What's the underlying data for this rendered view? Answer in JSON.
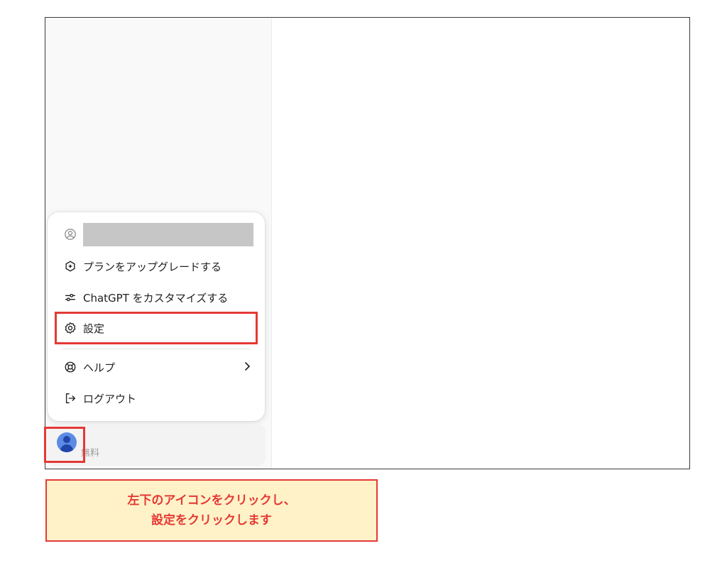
{
  "menu": {
    "account_icon": "user-circle-icon",
    "items": [
      {
        "label": "プランをアップグレードする",
        "icon": "upgrade-sparkle-icon"
      },
      {
        "label": "ChatGPT をカスタマイズする",
        "icon": "sliders-icon"
      },
      {
        "label": "設定",
        "icon": "gear-icon"
      },
      {
        "label": "ヘルプ",
        "icon": "lifebuoy-icon",
        "has_submenu": true
      },
      {
        "label": "ログアウト",
        "icon": "logout-icon"
      }
    ]
  },
  "profile": {
    "plan_label": "無料",
    "avatar_icon": "avatar-icon"
  },
  "callout": {
    "line1": "左下のアイコンをクリックし、",
    "line2": "設定をクリックします"
  },
  "colors": {
    "highlight": "#e53935",
    "callout_bg": "#fff2c8",
    "callout_text": "#e53935",
    "avatar": "#5b8be6"
  }
}
